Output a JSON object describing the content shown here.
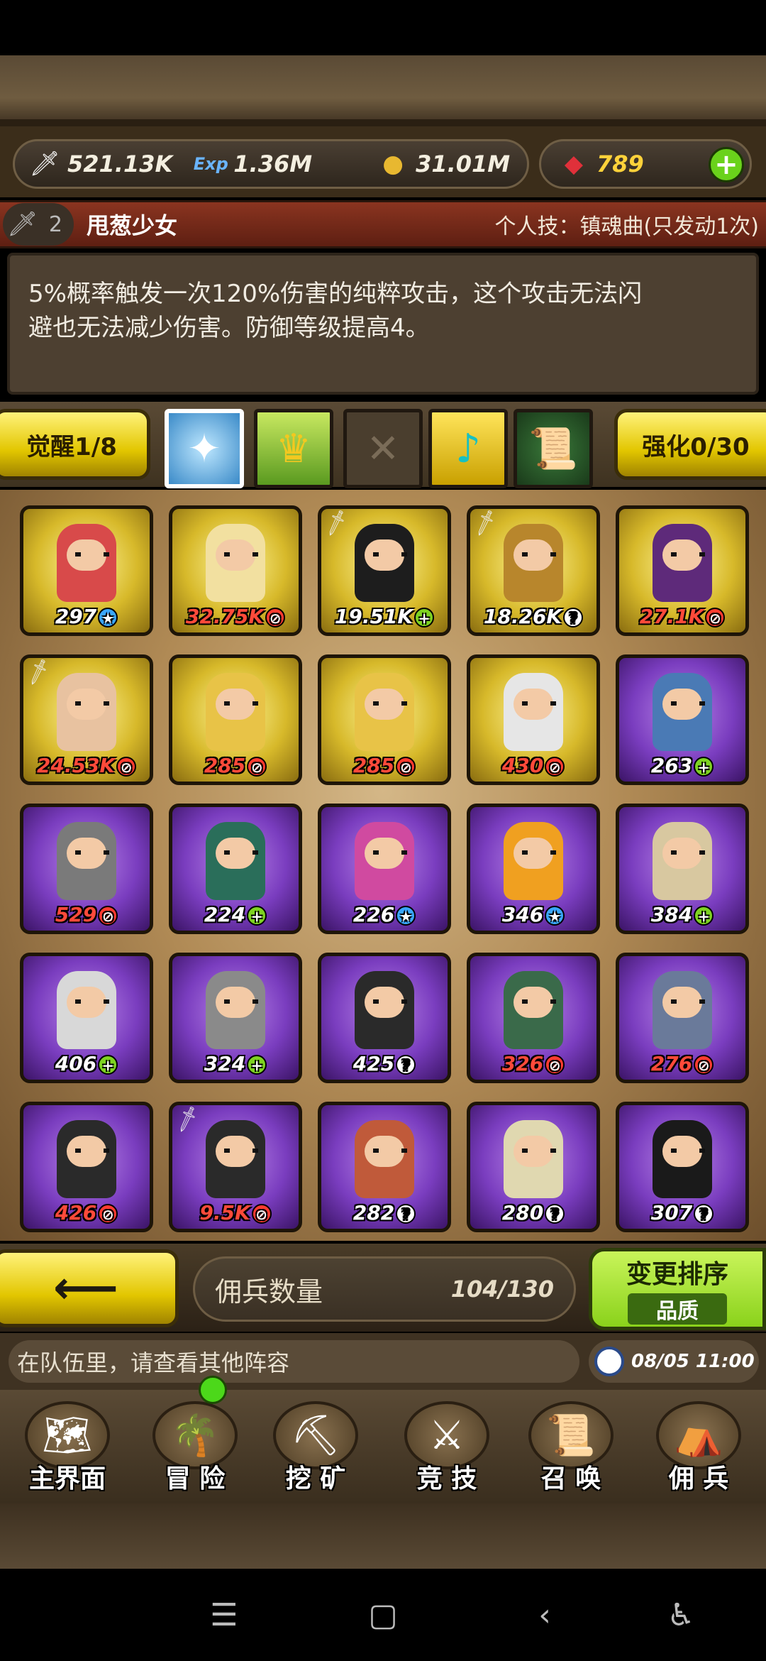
{
  "resources": {
    "power": "521.13K",
    "exp": "1.36M",
    "gold": "31.01M",
    "gems": "789"
  },
  "hero": {
    "level": "2",
    "name": "甩葱少女",
    "skill": "个人技：镇魂曲(只发动1次)",
    "desc_line1": "5%概率触发一次120%伤害的纯粹攻击，这个攻击无法闪",
    "desc_line2": "避也无法减少伤害。防御等级提高4。"
  },
  "tabs": {
    "awaken": "觉醒1/8",
    "enhance": "强化0/30"
  },
  "cards": [
    {
      "level": "297",
      "badge": "star",
      "rarity": "gold",
      "color": "#d84a4a",
      "equip": false
    },
    {
      "level": "32.75K",
      "badge": "no",
      "rarity": "gold",
      "color": "#f2e0a0",
      "equip": false
    },
    {
      "level": "19.51K",
      "badge": "plus",
      "rarity": "gold",
      "color": "#1d1d1d",
      "equip": true
    },
    {
      "level": "18.26K",
      "badge": "q",
      "rarity": "gold",
      "color": "#b8862c",
      "equip": true
    },
    {
      "level": "27.1K",
      "badge": "no",
      "rarity": "gold",
      "color": "#5e2a7a",
      "equip": false
    },
    {
      "level": "24.53K",
      "badge": "no",
      "rarity": "gold",
      "color": "#e8c2a0",
      "equip": true
    },
    {
      "level": "285",
      "badge": "no",
      "rarity": "gold",
      "color": "#e8c347",
      "equip": false
    },
    {
      "level": "285",
      "badge": "no",
      "rarity": "gold",
      "color": "#e8c347",
      "equip": false
    },
    {
      "level": "430",
      "badge": "no",
      "rarity": "gold",
      "color": "#e6e6e6",
      "equip": false
    },
    {
      "level": "263",
      "badge": "plus",
      "rarity": "purple",
      "color": "#4a7ab5",
      "equip": false
    },
    {
      "level": "529",
      "badge": "no",
      "rarity": "purple",
      "color": "#7a7a7a",
      "equip": false
    },
    {
      "level": "224",
      "badge": "plus",
      "rarity": "purple",
      "color": "#2a6e5a",
      "equip": false
    },
    {
      "level": "226",
      "badge": "star",
      "rarity": "purple",
      "color": "#d04aa0",
      "equip": false
    },
    {
      "level": "346",
      "badge": "star",
      "rarity": "purple",
      "color": "#f0a020",
      "equip": false
    },
    {
      "level": "384",
      "badge": "plus",
      "rarity": "purple",
      "color": "#d8c8a0",
      "equip": false
    },
    {
      "level": "406",
      "badge": "plus",
      "rarity": "purple",
      "color": "#d8d8d8",
      "equip": false
    },
    {
      "level": "324",
      "badge": "plus",
      "rarity": "purple",
      "color": "#8a8a8a",
      "equip": false
    },
    {
      "level": "425",
      "badge": "q",
      "rarity": "purple",
      "color": "#2a2a2a",
      "equip": false
    },
    {
      "level": "326",
      "badge": "no",
      "rarity": "purple",
      "color": "#3a6a4a",
      "equip": false
    },
    {
      "level": "276",
      "badge": "no",
      "rarity": "purple",
      "color": "#6a7a9a",
      "equip": false
    },
    {
      "level": "426",
      "badge": "no",
      "rarity": "purple",
      "color": "#2a2a2a",
      "equip": false
    },
    {
      "level": "9.5K",
      "badge": "no",
      "rarity": "purple",
      "color": "#2a2a2a",
      "equip": true
    },
    {
      "level": "282",
      "badge": "q",
      "rarity": "purple",
      "color": "#c05a3a",
      "equip": false
    },
    {
      "level": "280",
      "badge": "q",
      "rarity": "purple",
      "color": "#e0d8b0",
      "equip": false
    },
    {
      "level": "307",
      "badge": "q",
      "rarity": "purple",
      "color": "#1a1a1a",
      "equip": false
    }
  ],
  "footer": {
    "count_label": "佣兵数量",
    "count_value": "104/130",
    "sort_label": "变更排序",
    "sort_value": "品质",
    "message": "在队伍里，请查看其他阵容",
    "time": "08/05 11:00"
  },
  "nav": [
    "主界面",
    "冒 险",
    "挖 矿",
    "竞 技",
    "召 唤",
    "佣 兵"
  ]
}
